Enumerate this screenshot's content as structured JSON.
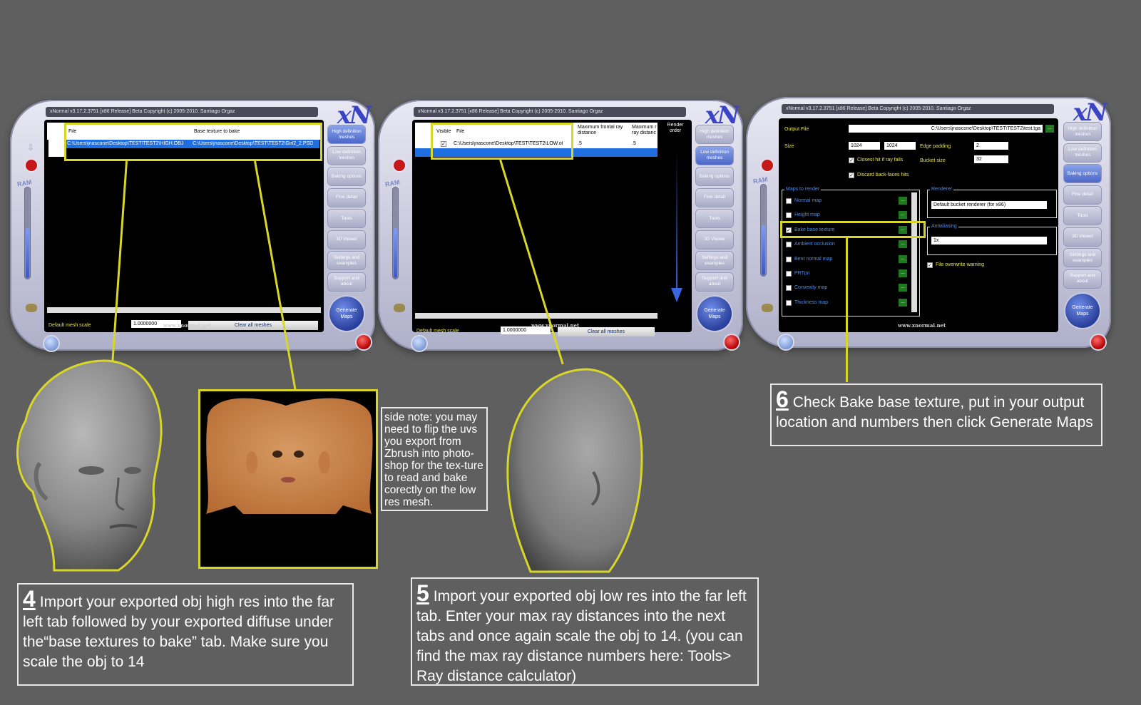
{
  "app_title": "xNormal v3.17.2.3751 [x86 Release] Beta Copyright (c) 2005-2010. Santiago Orgaz",
  "logo_text": "xN",
  "ram_label": "RAM",
  "website": "www.xnormal.net",
  "generate_label": "Generate Maps",
  "sidebar": [
    "High definition meshes",
    "Low definition meshes",
    "Baking options",
    "Fine detail",
    "Tools",
    "3D Viewer",
    "Settings and examples",
    "Support and about"
  ],
  "panel1": {
    "col_file": "File",
    "col_texture": "Base texture to bake",
    "row_file": "C:\\Users\\jnascone\\Desktop\\TEST\\TEST2\\HIGH.OBJ",
    "row_texture": "C:\\Users\\jnascone\\Desktop\\TEST\\TEST2\\Girl2_2.PSD",
    "scale_label": "Default mesh scale",
    "scale_value": "1.0000000",
    "clear_label": "Clear all meshes"
  },
  "panel2": {
    "col_visible": "Visible",
    "col_file": "File",
    "col_maxfront": "Maximum frontal ray distance",
    "col_maxrear": "Maximum r ray distanc",
    "col_render": "Render order",
    "row_file": "C:\\Users\\jnascone\\Desktop\\TEST\\TEST2\\LOW.ol",
    "row_front": ".5",
    "row_rear": ".5",
    "row_checked": true,
    "scale_label": "Default mesh scale",
    "scale_value": "1.0000000",
    "clear_label": "Clear all meshes"
  },
  "panel3": {
    "output_label": "Output File",
    "output_value": "C:\\Users\\jnascone\\Desktop\\TEST\\TEST2\\test.tga",
    "size_label": "Size",
    "size_w": "1024",
    "size_h": "1024",
    "edge_label": "Edge padding",
    "edge_value": "2",
    "bucket_label": "Bucket size",
    "bucket_value": "32",
    "closest_label": "Closest hit if ray fails",
    "discard_label": "Discard back-faces hits",
    "maps_label": "Maps to render",
    "maps": [
      {
        "label": "Normal map",
        "checked": false
      },
      {
        "label": "Height map",
        "checked": false
      },
      {
        "label": "Bake base texture",
        "checked": true
      },
      {
        "label": "Ambient occlusion",
        "checked": false
      },
      {
        "label": "Bent normal map",
        "checked": false
      },
      {
        "label": "PRTpn",
        "checked": false
      },
      {
        "label": "Convexity map",
        "checked": false
      },
      {
        "label": "Thickness map",
        "checked": false
      }
    ],
    "dots": "...",
    "renderer_label": "Renderer",
    "renderer_value": "Default bucket renderer (for x86)",
    "aa_label": "Antialiasing",
    "aa_value": "1x",
    "overwrite_label": "File overwrite warning"
  },
  "captions": {
    "c4_num": "4",
    "c4_text": "Import your exported obj high res into the far left tab followed by your exported diffuse  under the“base textures to bake” tab. Make sure you scale the obj to  14",
    "c5_num": "5",
    "c5_text": "Import your exported obj low res into the far left tab. Enter your max ray distances into the next tabs and once again scale the obj to 14. (you can find the max ray distance numbers here: Tools> Ray distance calculator)",
    "c6_num": "6",
    "c6_text": "Check Bake base texture, put in your output location and numbers then click Generate Maps",
    "side_note": "side note: you may need to flip the uvs you export from Zbrush into photo-shop for the tex-ture to read and bake corectly on the low res mesh."
  },
  "colors": {
    "background": "#5f5f5f",
    "highlight": "#d8d629",
    "selection": "#1e6ee0",
    "skin": "#c98449"
  }
}
